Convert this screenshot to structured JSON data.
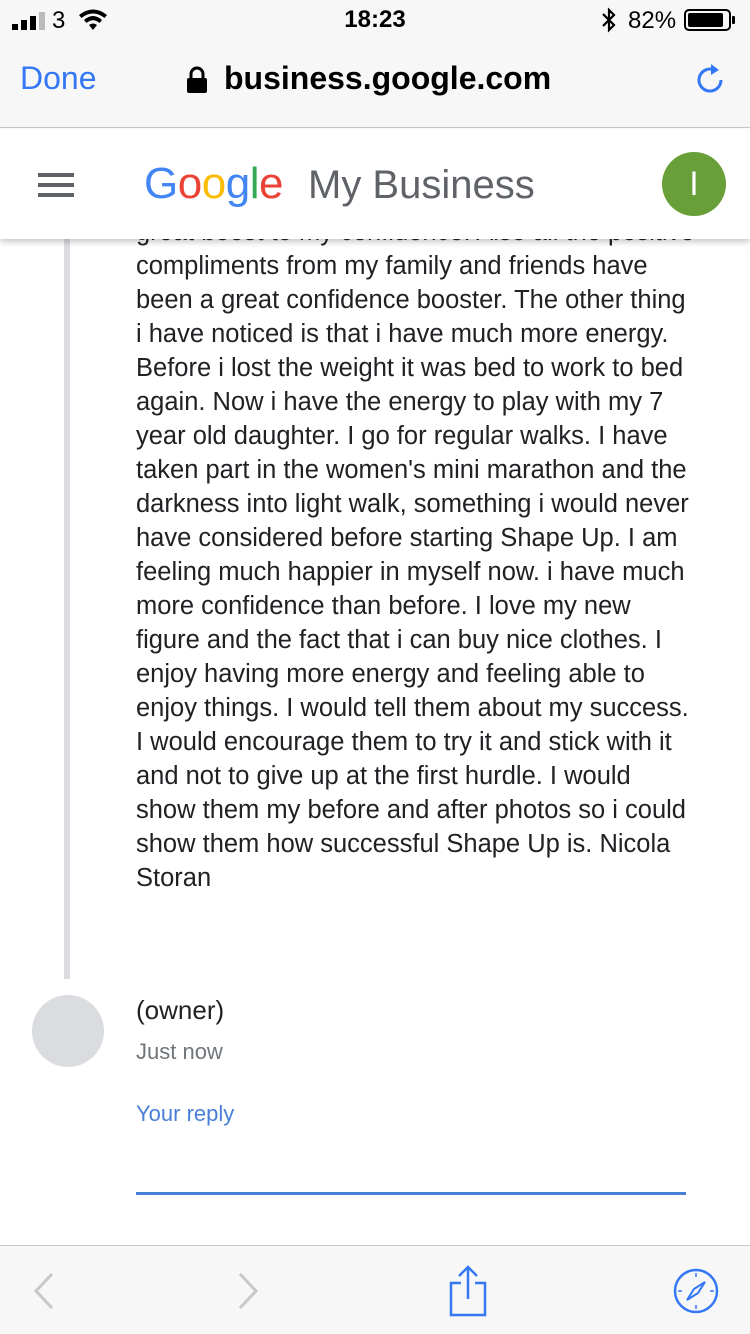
{
  "status_bar": {
    "carrier": "3",
    "time": "18:23",
    "battery_percent": "82%"
  },
  "browser": {
    "done_label": "Done",
    "url": "business.google.com"
  },
  "app": {
    "logo_letters": [
      "G",
      "o",
      "o",
      "g",
      "l",
      "e"
    ],
    "product_name": "My Business",
    "account_initial": "I"
  },
  "review": {
    "text": "great boost to my confidence. Also all the positive compliments from my family and friends have been a great confidence booster. The other thing i have noticed is that i have much more energy. Before i lost the weight it was bed to work to bed again. Now i have the energy to play with my 7 year old daughter. I go for regular walks. I have taken part in the women's mini marathon and the darkness into light walk, something i would never have considered before starting Shape Up. I am feeling much happier in myself now. i have much more confidence than before. I love my new figure and the fact that i can buy nice clothes. I enjoy having more energy and feeling able to enjoy things. I would tell them about my success. I would encourage them to try it and stick with it and not to give up at the first hurdle. I would show them my before and after photos so i could show them how successful Shape Up is. Nicola Storan"
  },
  "owner_reply": {
    "name": "(owner)",
    "time": "Just now",
    "reply_label": "Your reply",
    "reply_value": ""
  },
  "colors": {
    "ios_blue": "#3478f6",
    "link_blue": "#4a7fd8",
    "avatar_green": "#689f38",
    "toolbar_disabled": "#c7c7cc"
  }
}
